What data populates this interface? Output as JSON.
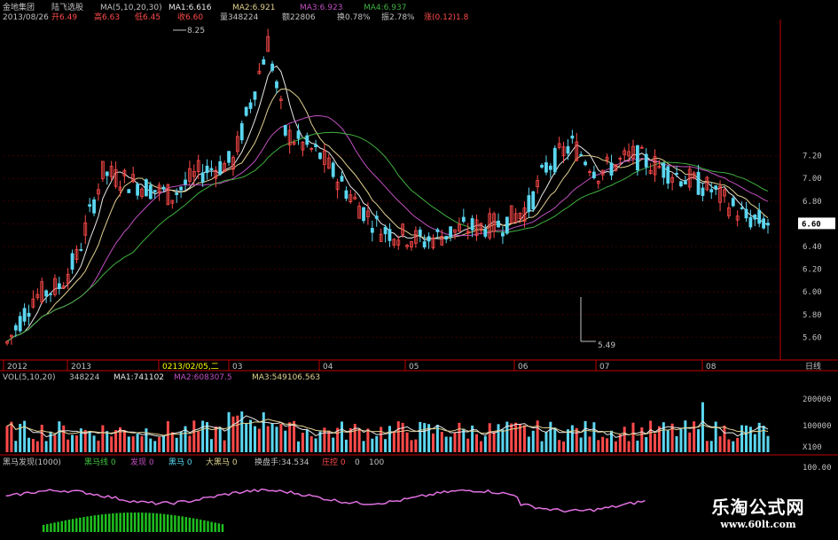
{
  "colors": {
    "up": "#ff4a4a",
    "down": "#5bd6f0",
    "ma1": "#e8e8e8",
    "ma2": "#e0d090",
    "ma3": "#c050c0",
    "ma4": "#40b040",
    "grid": "#3a0000",
    "axis": "#c00000",
    "label": "#c0c0c0",
    "highlight": "#ffff00",
    "vol_line": "#e8e8e8",
    "osc": "#e070e0",
    "osc_bar": "#1fbf1f"
  },
  "header": {
    "line1": {
      "name": "金地集团",
      "title": "陆飞选股",
      "ma_params": "MA(5,10,20,30)",
      "ma1": "MA1:6.616",
      "ma2": "MA2:6.921",
      "ma3": "MA3:6.923",
      "ma4": "MA4:6.937"
    },
    "line2": {
      "date": "2013/08/26",
      "open": "开6.49",
      "high": "高6.63",
      "low": "低6.45",
      "close": "收6.60",
      "vol": "量348224",
      "amount": "额22806",
      "turn": "换0.78%",
      "amp": "振2.78%",
      "chg": "涨(0.12)1.8"
    }
  },
  "chart_data": [
    {
      "type": "candlestick",
      "ylim": [
        5.4,
        8.4
      ],
      "y_ticks": [
        "7.20",
        "7.00",
        "6.80",
        "6.60",
        "6.40",
        "6.20",
        "6.00",
        "5.80",
        "5.60"
      ],
      "y_tick_values": [
        7.2,
        7.0,
        6.8,
        6.6,
        6.4,
        6.2,
        6.0,
        5.8,
        5.6
      ],
      "current_price": "6.60",
      "x_labels": [
        "2012",
        "2013",
        "0213/02/05,二",
        "03",
        "04",
        "05",
        "06",
        "07",
        "08",
        "日线"
      ],
      "annotations": [
        "8.25",
        "5.49"
      ]
    },
    {
      "type": "bar",
      "title": "VOL(5,10,20)",
      "vol": "348224",
      "vma1": "MA1:741102",
      "vma2": "MA2:608307.5",
      "vma3": "MA3:549106.563",
      "y_ticks": [
        "200000",
        "100000",
        "X100"
      ]
    },
    {
      "type": "line",
      "title": "黑马发现(1000)",
      "legend": [
        "黑马线 0",
        "发现 0",
        "黑马 0",
        "大黑马 0",
        "换盘手:34.534",
        "庄控 0",
        "0",
        "100"
      ],
      "y_ticks": [
        "100.00"
      ]
    }
  ],
  "watermark": {
    "cn": "乐淘公式网",
    "url": "www.60lt.com"
  }
}
